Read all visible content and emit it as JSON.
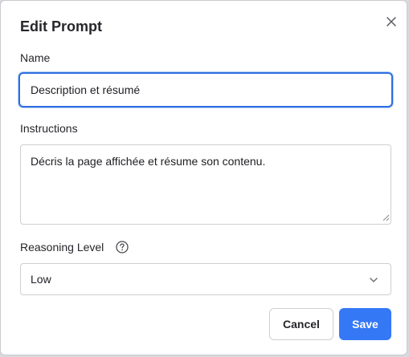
{
  "dialog": {
    "title": "Edit Prompt",
    "close_icon": "close-icon"
  },
  "name": {
    "label": "Name",
    "value": "Description et résumé"
  },
  "instructions": {
    "label": "Instructions",
    "value": "Décris la page affichée et résume son contenu."
  },
  "reasoning": {
    "label": "Reasoning Level",
    "help_icon": "help-circle-icon",
    "selected": "Low",
    "chevron_icon": "chevron-down-icon"
  },
  "actions": {
    "cancel_label": "Cancel",
    "save_label": "Save"
  },
  "colors": {
    "accent": "#3478f6",
    "focus_border": "#2d6fe0",
    "text": "#26262b",
    "border": "#cfcfd4"
  }
}
